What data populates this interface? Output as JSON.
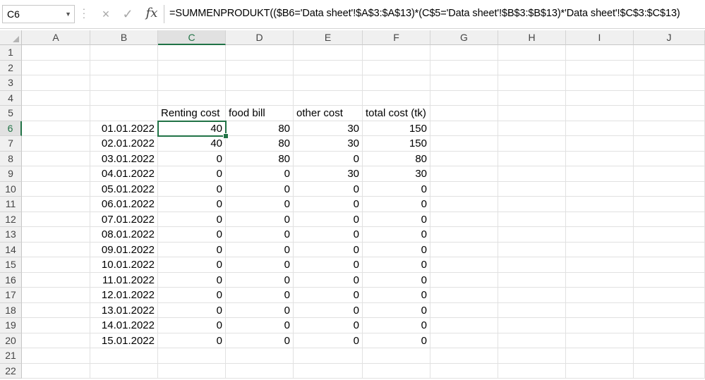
{
  "name_box": "C6",
  "formula": "=SUMMENPRODUKT(($B6='Data sheet'!$A$3:$A$13)*(C$5='Data sheet'!$B$3:$B$13)*'Data sheet'!$C$3:$C$13)",
  "icons": {
    "cancel": "×",
    "enter": "✓",
    "function": "fx"
  },
  "columns": [
    "A",
    "B",
    "C",
    "D",
    "E",
    "F",
    "G",
    "H",
    "I",
    "J"
  ],
  "rows": [
    "1",
    "2",
    "3",
    "4",
    "5",
    "6",
    "7",
    "8",
    "9",
    "10",
    "11",
    "12",
    "13",
    "14",
    "15",
    "16",
    "17",
    "18",
    "19",
    "20",
    "21",
    "22"
  ],
  "selected_col": "C",
  "selected_row": "6",
  "headers": {
    "c": "Renting cost",
    "d": "food bill",
    "e": "other cost",
    "f": "total cost (tk)"
  },
  "data_rows": [
    {
      "date": "01.01.2022",
      "c": "40",
      "d": "80",
      "e": "30",
      "f": "150"
    },
    {
      "date": "02.01.2022",
      "c": "40",
      "d": "80",
      "e": "30",
      "f": "150"
    },
    {
      "date": "03.01.2022",
      "c": "0",
      "d": "80",
      "e": "0",
      "f": "80"
    },
    {
      "date": "04.01.2022",
      "c": "0",
      "d": "0",
      "e": "30",
      "f": "30"
    },
    {
      "date": "05.01.2022",
      "c": "0",
      "d": "0",
      "e": "0",
      "f": "0"
    },
    {
      "date": "06.01.2022",
      "c": "0",
      "d": "0",
      "e": "0",
      "f": "0"
    },
    {
      "date": "07.01.2022",
      "c": "0",
      "d": "0",
      "e": "0",
      "f": "0"
    },
    {
      "date": "08.01.2022",
      "c": "0",
      "d": "0",
      "e": "0",
      "f": "0"
    },
    {
      "date": "09.01.2022",
      "c": "0",
      "d": "0",
      "e": "0",
      "f": "0"
    },
    {
      "date": "10.01.2022",
      "c": "0",
      "d": "0",
      "e": "0",
      "f": "0"
    },
    {
      "date": "11.01.2022",
      "c": "0",
      "d": "0",
      "e": "0",
      "f": "0"
    },
    {
      "date": "12.01.2022",
      "c": "0",
      "d": "0",
      "e": "0",
      "f": "0"
    },
    {
      "date": "13.01.2022",
      "c": "0",
      "d": "0",
      "e": "0",
      "f": "0"
    },
    {
      "date": "14.01.2022",
      "c": "0",
      "d": "0",
      "e": "0",
      "f": "0"
    },
    {
      "date": "15.01.2022",
      "c": "0",
      "d": "0",
      "e": "0",
      "f": "0"
    }
  ]
}
